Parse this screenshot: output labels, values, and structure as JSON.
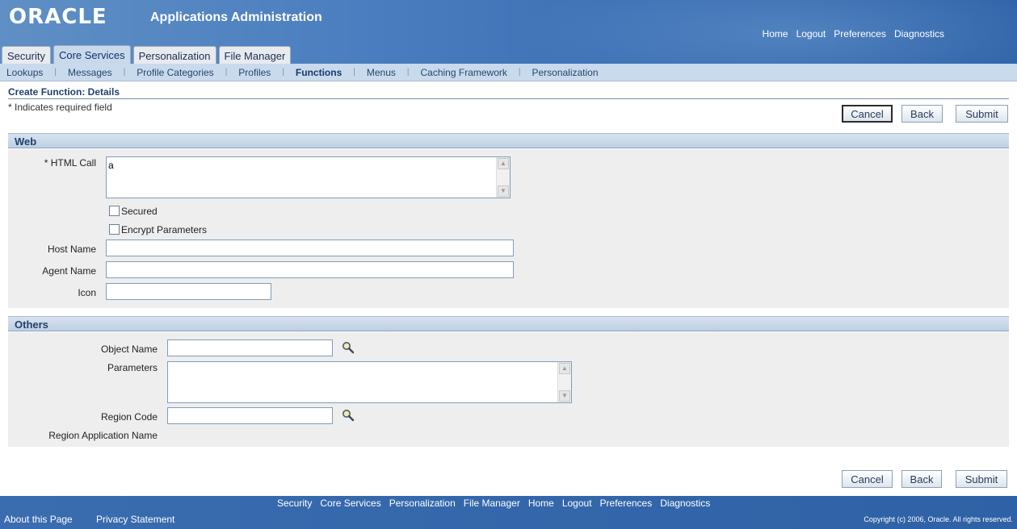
{
  "header": {
    "logo": "ORACLE",
    "app_title": "Applications Administration",
    "global_links": [
      "Home",
      "Logout",
      "Preferences",
      "Diagnostics"
    ]
  },
  "tabs": [
    {
      "label": "Security",
      "active": false
    },
    {
      "label": "Core Services",
      "active": true
    },
    {
      "label": "Personalization",
      "active": false
    },
    {
      "label": "File Manager",
      "active": false
    }
  ],
  "subnav": [
    {
      "label": "Lookups",
      "active": false
    },
    {
      "label": "Messages",
      "active": false
    },
    {
      "label": "Profile Categories",
      "active": false
    },
    {
      "label": "Profiles",
      "active": false
    },
    {
      "label": "Functions",
      "active": true
    },
    {
      "label": "Menus",
      "active": false
    },
    {
      "label": "Caching Framework",
      "active": false
    },
    {
      "label": "Personalization",
      "active": false
    }
  ],
  "page": {
    "title": "Create Function: Details",
    "required_note": "*  Indicates required field"
  },
  "buttons": {
    "cancel": "Cancel",
    "back": "Back",
    "submit": "Submit"
  },
  "web_section": {
    "header": "Web",
    "html_call_label": "* HTML Call",
    "html_call_value": "a",
    "secured_label": "Secured",
    "encrypt_label": "Encrypt Parameters",
    "host_name_label": "Host Name",
    "host_name_value": "",
    "agent_name_label": "Agent Name",
    "agent_name_value": "",
    "icon_label": "Icon",
    "icon_value": ""
  },
  "others_section": {
    "header": "Others",
    "object_name_label": "Object Name",
    "object_name_value": "",
    "parameters_label": "Parameters",
    "parameters_value": "",
    "region_code_label": "Region Code",
    "region_code_value": "",
    "region_app_name_label": "Region Application Name"
  },
  "footer": {
    "links": [
      "Security",
      "Core Services",
      "Personalization",
      "File Manager",
      "Home",
      "Logout",
      "Preferences",
      "Diagnostics"
    ],
    "about": "About this Page",
    "privacy": "Privacy Statement",
    "copyright": "Copyright (c) 2006, Oracle. All rights reserved."
  },
  "icons": {
    "lov": "magnifier-search-icon",
    "scroll_up": "scroll-up-arrow-icon",
    "scroll_down": "scroll-down-arrow-icon"
  },
  "colors": {
    "brand_blue": "#3d71b5",
    "section_header": "#c9daec",
    "title_text": "#22406b"
  }
}
